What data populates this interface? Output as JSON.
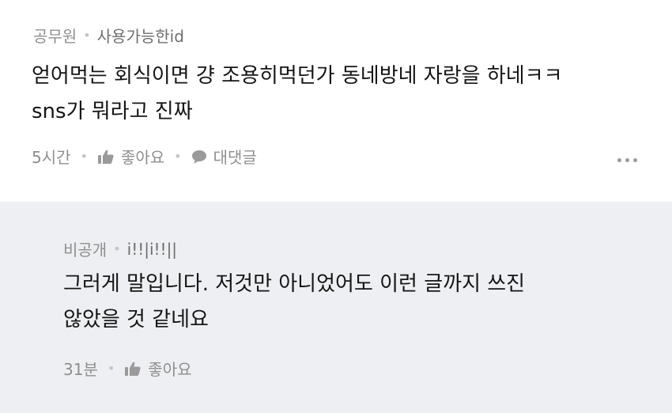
{
  "comments": [
    {
      "author": "공무원",
      "user_id": "사용가능한id",
      "lines": [
        "얻어먹는 회식이면 걍 조용히먹던가 동네방네 자랑을 하네ㅋㅋ",
        "sns가 뭐라고 진짜"
      ],
      "time": "5시간",
      "like_label": "좋아요",
      "reply_label": "대댓글"
    },
    {
      "author": "비공개",
      "user_id": "i!!|i!!||",
      "lines": [
        "그러게 말입니다. 저것만 아니었어도 이런 글까지 쓰진",
        "않았을 것 같네요"
      ],
      "time": "31분",
      "like_label": "좋아요"
    }
  ],
  "icons": {
    "like": "thumbs-up-icon",
    "reply": "speech-bubble-icon",
    "more": "more-dots-icon"
  },
  "colors": {
    "reply_background": "#eeeff2",
    "text": "#151515",
    "meta": "#8f8f8f"
  }
}
